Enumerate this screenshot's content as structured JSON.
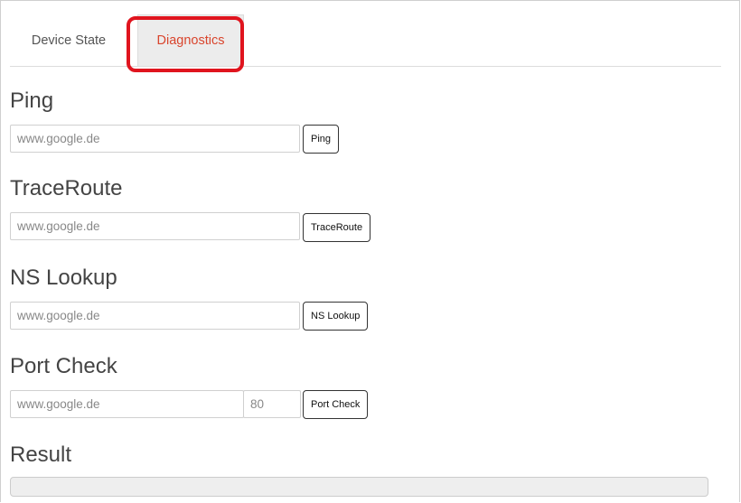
{
  "tabs": {
    "device_state": "Device State",
    "diagnostics": "Diagnostics"
  },
  "ping": {
    "title": "Ping",
    "host_value": "www.google.de",
    "button": "Ping"
  },
  "traceroute": {
    "title": "TraceRoute",
    "host_value": "www.google.de",
    "button": "TraceRoute"
  },
  "nslookup": {
    "title": "NS Lookup",
    "host_value": "www.google.de",
    "button": "NS Lookup"
  },
  "portcheck": {
    "title": "Port Check",
    "host_value": "www.google.de",
    "port_value": "80",
    "button": "Port Check"
  },
  "result": {
    "title": "Result",
    "value": ""
  },
  "colors": {
    "active_tab_text": "#d9452d",
    "highlight": "#e0141e"
  }
}
